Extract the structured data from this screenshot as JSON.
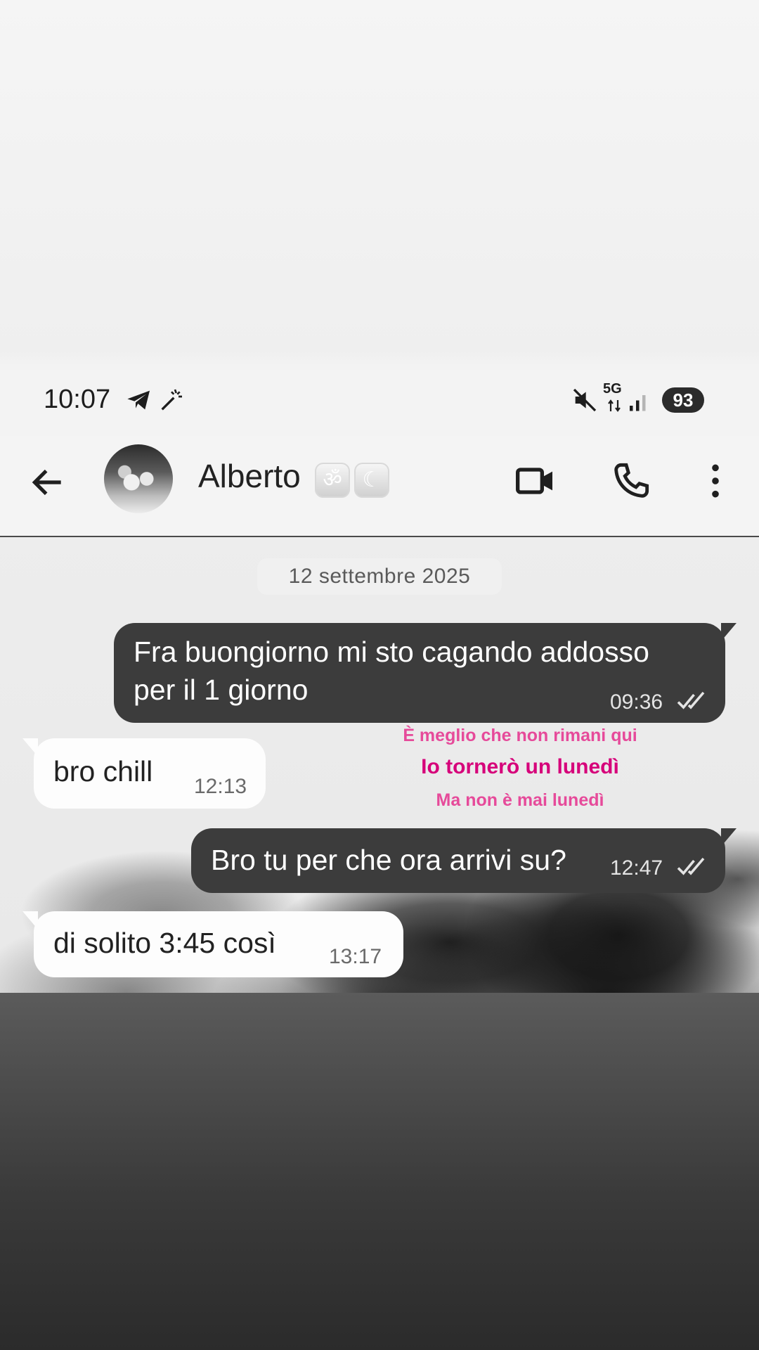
{
  "status_bar": {
    "time": "10:07",
    "network": "5G",
    "battery": "93",
    "icons": [
      "telegram-icon",
      "magic-wand-icon",
      "mute-icon",
      "data-arrows-icon",
      "signal-icon"
    ]
  },
  "header": {
    "contact_name": "Alberto",
    "emojis": [
      "ॐ",
      "☾"
    ],
    "actions": [
      "back-arrow-icon",
      "video-call-icon",
      "phone-icon",
      "more-vert-icon"
    ]
  },
  "date_label": "12 settembre 2025",
  "messages": [
    {
      "direction": "out",
      "text_line1": "Fra buongiorno mi sto cagando addosso",
      "text_line2": "per il 1 giorno",
      "time": "09:36",
      "status": "read"
    },
    {
      "direction": "in",
      "text": "bro chill",
      "time": "12:13"
    },
    {
      "direction": "out",
      "text": "Bro tu per che ora arrivi su?",
      "time": "12:47",
      "status": "read"
    },
    {
      "direction": "in",
      "text": "di solito 3:45 così",
      "time": "13:17"
    }
  ],
  "lyrics": [
    "È meglio che non rimani qui",
    "Io tornerò un lunedì",
    "Ma non è mai lunedì"
  ],
  "colors": {
    "outgoing_bubble": "#3c3c3c",
    "incoming_bubble": "#fdfdfd",
    "lyric_pink": "#e64a9a",
    "lyric_magenta": "#d6007a"
  }
}
